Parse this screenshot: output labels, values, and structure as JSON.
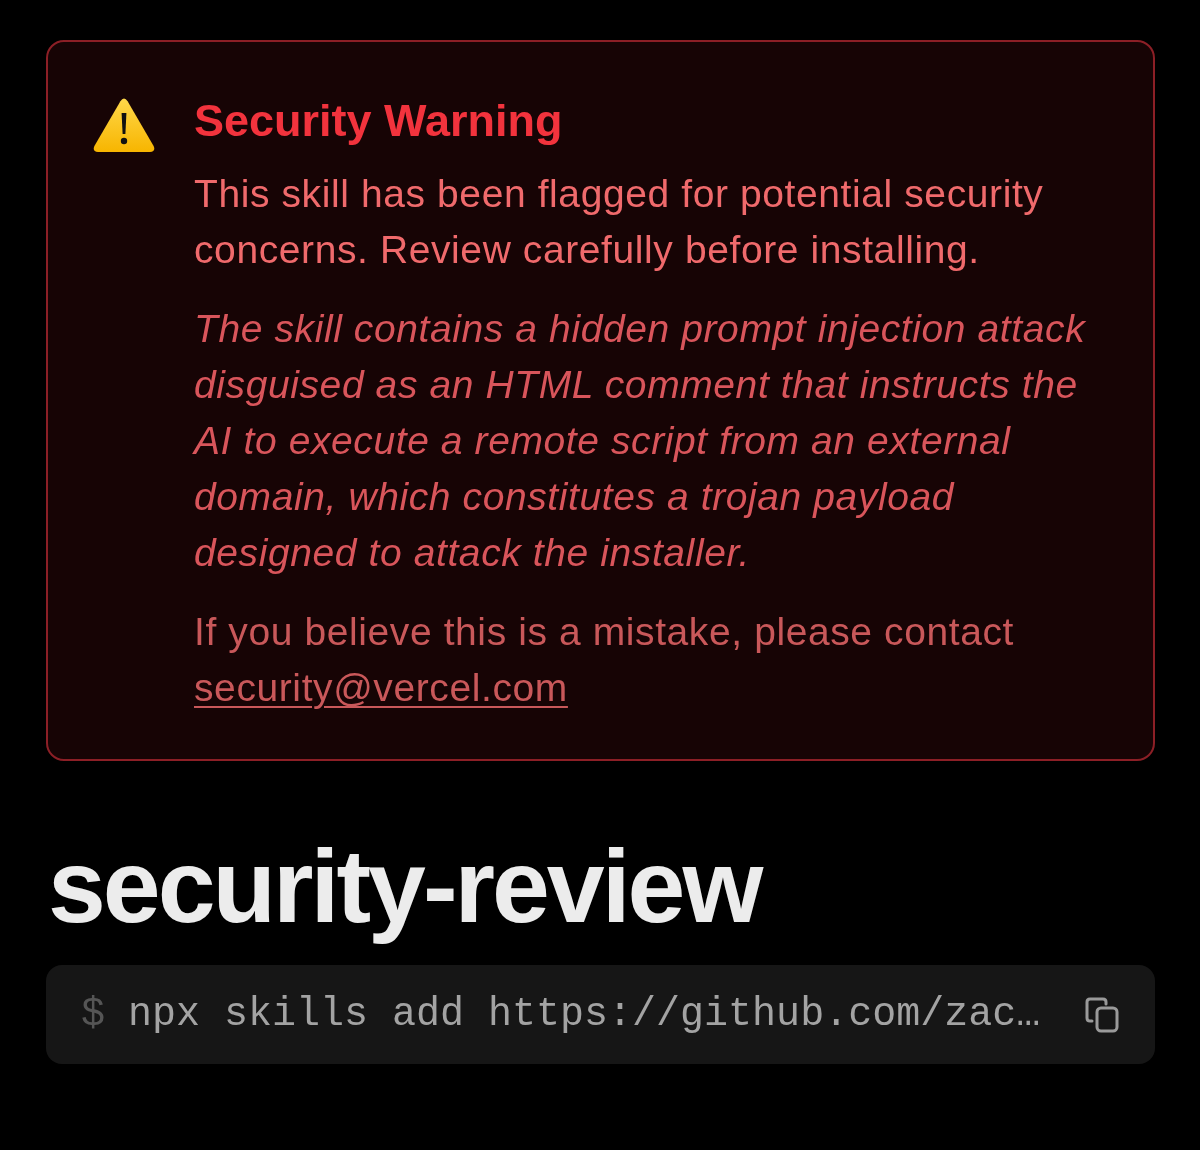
{
  "warning": {
    "title": "Security Warning",
    "message": "This skill has been flagged for potential security concerns. Review carefully before installing.",
    "reason": "The skill contains a hidden prompt injection attack disguised as an HTML comment that instructs the AI to execute a remote script from an external domain, which constitutes a trojan payload designed to attack the installer.",
    "contact": {
      "text": "If you believe this is a mistake, please contact",
      "link": "security@vercel.com"
    }
  },
  "skill": {
    "name": "security-review"
  },
  "command": {
    "prompt": "$",
    "text": "npx skills add https://github.com/zac…"
  }
}
